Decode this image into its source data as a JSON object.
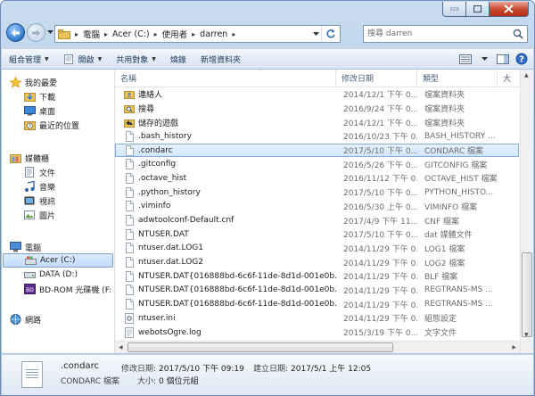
{
  "window": {
    "caption_buttons": [
      "minimize",
      "maximize",
      "close"
    ]
  },
  "address": {
    "crumbs": [
      "電腦",
      "Acer (C:)",
      "使用者",
      "darren"
    ]
  },
  "search": {
    "placeholder": "搜尋 darren"
  },
  "toolbar": {
    "organize": "組合管理",
    "open": "開啟",
    "share": "共用對象",
    "burn": "燒錄",
    "new_folder": "新增資料夾"
  },
  "navpane": {
    "favorites": "我的最愛",
    "downloads": "下載",
    "desktop": "桌面",
    "recent": "最近的位置",
    "libraries": "媒體櫃",
    "documents": "文件",
    "music": "音樂",
    "videos": "視訊",
    "pictures": "圖片",
    "computer": "電腦",
    "drive_c": "Acer (C:)",
    "drive_d": "DATA (D:)",
    "bd_rom": "BD-ROM 光碟機 (F:",
    "network": "網路"
  },
  "columns": {
    "name": "名稱",
    "date": "修改日期",
    "type": "類型",
    "size": "大"
  },
  "files": [
    {
      "name": "連絡人",
      "date": "2014/12/1 下午 0...",
      "type": "檔案資料夾",
      "icon": "contacts-folder-icon"
    },
    {
      "name": "搜尋",
      "date": "2016/9/24 下午 0...",
      "type": "檔案資料夾",
      "icon": "search-folder-icon"
    },
    {
      "name": "儲存的遊戲",
      "date": "2014/12/1 下午 0...",
      "type": "檔案資料夾",
      "icon": "saved-games-folder-icon"
    },
    {
      "name": ".bash_history",
      "date": "2016/10/23 下午 0...",
      "type": "BASH_HISTORY ...",
      "icon": "file-icon"
    },
    {
      "name": ".condarc",
      "date": "2017/5/10 下午 0...",
      "type": "CONDARC 檔案",
      "icon": "file-icon"
    },
    {
      "name": ".gitconfig",
      "date": "2016/5/26 下午 0...",
      "type": "GITCONFIG 檔案",
      "icon": "file-icon"
    },
    {
      "name": ".octave_hist",
      "date": "2016/11/12 下午 0...",
      "type": "OCTAVE_HIST 檔案",
      "icon": "file-icon"
    },
    {
      "name": ".python_history",
      "date": "2017/5/10 下午 0...",
      "type": "PYTHON_HISTO...",
      "icon": "file-icon"
    },
    {
      "name": ".viminfo",
      "date": "2016/5/30 上午 0...",
      "type": "VIMINFO 檔案",
      "icon": "file-icon"
    },
    {
      "name": "adwtoolconf-Default.cnf",
      "date": "2017/4/9 下午 11...",
      "type": "CNF 檔案",
      "icon": "file-icon"
    },
    {
      "name": "NTUSER.DAT",
      "date": "2017/5/10 下午 0...",
      "type": "dat 媒體文件",
      "icon": "file-icon"
    },
    {
      "name": "ntuser.dat.LOG1",
      "date": "2014/11/29 下午 0...",
      "type": "LOG1 檔案",
      "icon": "file-icon"
    },
    {
      "name": "ntuser.dat.LOG2",
      "date": "2014/11/29 下午 0...",
      "type": "LOG2 檔案",
      "icon": "file-icon"
    },
    {
      "name": "NTUSER.DAT{016888bd-6c6f-11de-8d1d-001e0b...",
      "date": "2014/11/29 下午 0...",
      "type": "BLF 檔案",
      "icon": "file-icon"
    },
    {
      "name": "NTUSER.DAT{016888bd-6c6f-11de-8d1d-001e0b...",
      "date": "2014/11/29 下午 0...",
      "type": "REGTRANS-MS ...",
      "icon": "file-icon"
    },
    {
      "name": "NTUSER.DAT{016888bd-6c6f-11de-8d1d-001e0b...",
      "date": "2014/11/29 下午 0...",
      "type": "REGTRANS-MS ...",
      "icon": "file-icon"
    },
    {
      "name": "ntuser.ini",
      "date": "2014/11/29 下午 0...",
      "type": "組態設定",
      "icon": "settings-file-icon"
    },
    {
      "name": "webotsOgre.log",
      "date": "2015/3/19 下午 0...",
      "type": "文字文件",
      "icon": "text-file-icon"
    }
  ],
  "selected_index": 4,
  "details": {
    "name": ".condarc",
    "type": "CONDARC 檔案",
    "modified_label": "修改日期:",
    "modified": "2017/5/10 下午 09:19",
    "created_label": "建立日期:",
    "created": "2017/5/1 上午 12:05",
    "size_label": "大小:",
    "size": "0 個位元組"
  }
}
